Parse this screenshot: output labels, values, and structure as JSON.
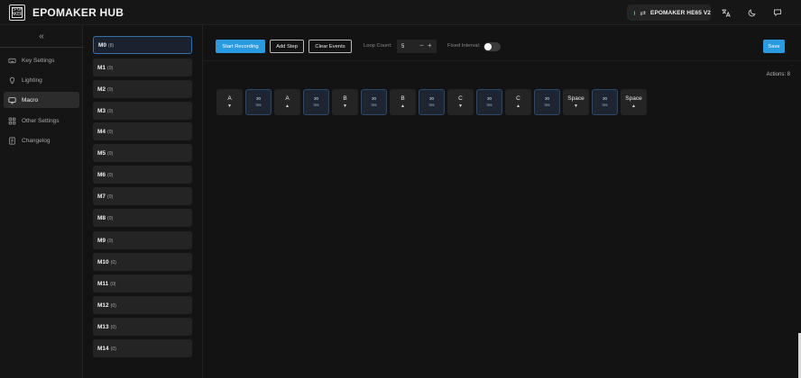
{
  "header": {
    "logo_mark": "EPOM AKER",
    "app_title": "EPOMAKER HUB",
    "device_name": "EPOMAKER HE65 V2",
    "device_status_color": "#2ec27e",
    "icons": [
      "swap-icon",
      "translate-icon",
      "moon-icon",
      "chat-icon"
    ]
  },
  "sidebar": {
    "collapse_glyph": "«",
    "items": [
      {
        "label": "Key Settings",
        "icon": "keyboard-icon",
        "active": false
      },
      {
        "label": "Lighting",
        "icon": "lightbulb-icon",
        "active": false
      },
      {
        "label": "Macro",
        "icon": "monitor-icon",
        "active": true
      },
      {
        "label": "Other Settings",
        "icon": "grid-icon",
        "active": false
      },
      {
        "label": "Changelog",
        "icon": "document-icon",
        "active": false
      }
    ]
  },
  "macros": [
    {
      "name": "M0",
      "count": "(8)",
      "active": true
    },
    {
      "name": "M1",
      "count": "(0)"
    },
    {
      "name": "M2",
      "count": "(0)"
    },
    {
      "name": "M3",
      "count": "(0)"
    },
    {
      "name": "M4",
      "count": "(0)"
    },
    {
      "name": "M5",
      "count": "(0)"
    },
    {
      "name": "M6",
      "count": "(0)"
    },
    {
      "name": "M7",
      "count": "(0)"
    },
    {
      "name": "M8",
      "count": "(0)"
    },
    {
      "name": "M9",
      "count": "(0)"
    },
    {
      "name": "M10",
      "count": "(0)"
    },
    {
      "name": "M11",
      "count": "(0)"
    },
    {
      "name": "M12",
      "count": "(0)"
    },
    {
      "name": "M13",
      "count": "(0)"
    },
    {
      "name": "M14",
      "count": "(0)"
    }
  ],
  "toolbar": {
    "start_recording": "Start Recording",
    "add_step": "Add Step",
    "clear_events": "Clear Events",
    "loop_count_label": "Loop Count:",
    "loop_count_value": "5",
    "minus": "−",
    "plus": "+",
    "fixed_interval_label": "Fixed Interval:",
    "fixed_interval_on": false,
    "save": "Save"
  },
  "actions_count": "Actions: 8",
  "actions": [
    {
      "kind": "key",
      "key": "A",
      "arrow": "▼"
    },
    {
      "kind": "delay",
      "value": "30",
      "unit": "ms"
    },
    {
      "kind": "key",
      "key": "A",
      "arrow": "▲"
    },
    {
      "kind": "delay",
      "value": "30",
      "unit": "ms"
    },
    {
      "kind": "key",
      "key": "B",
      "arrow": "▼"
    },
    {
      "kind": "delay",
      "value": "30",
      "unit": "ms"
    },
    {
      "kind": "key",
      "key": "B",
      "arrow": "▲"
    },
    {
      "kind": "delay",
      "value": "30",
      "unit": "ms"
    },
    {
      "kind": "key",
      "key": "C",
      "arrow": "▼"
    },
    {
      "kind": "delay",
      "value": "30",
      "unit": "ms"
    },
    {
      "kind": "key",
      "key": "C",
      "arrow": "▲"
    },
    {
      "kind": "delay",
      "value": "30",
      "unit": "ms"
    },
    {
      "kind": "key",
      "key": "Space",
      "arrow": "▼"
    },
    {
      "kind": "delay",
      "value": "30",
      "unit": "ms"
    },
    {
      "kind": "key",
      "key": "Space",
      "arrow": "▲"
    }
  ],
  "colors": {
    "accent": "#2b9be0",
    "background": "#131313",
    "panel": "#242424"
  }
}
